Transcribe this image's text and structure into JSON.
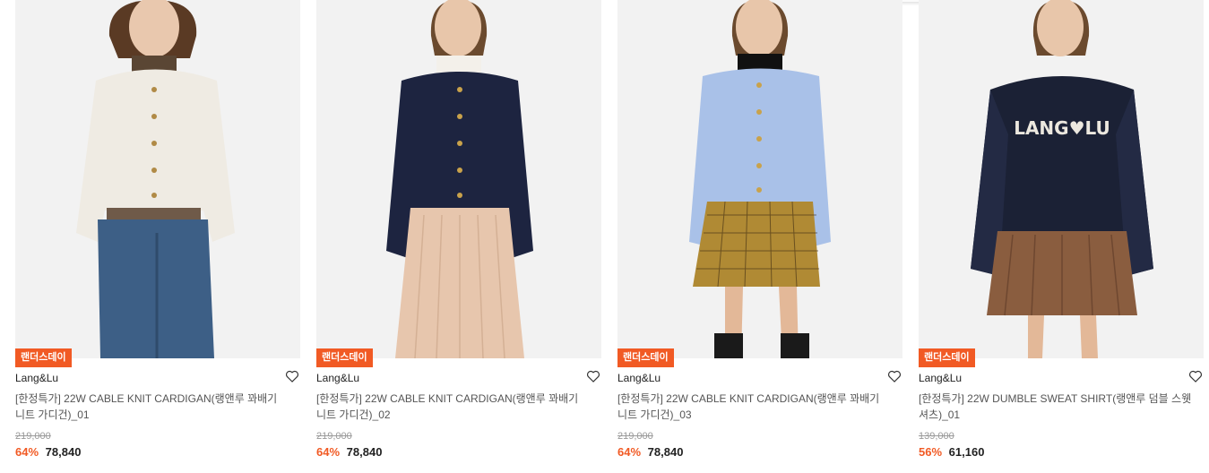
{
  "products": [
    {
      "badge": "랜더스데이",
      "brand": "Lang&Lu",
      "title": "[한정특가] 22W CABLE KNIT CARDIGAN(랭앤루 꽈배기 니트 가디건)_01",
      "original_price": "219,000",
      "discount": "64%",
      "sale_price": "78,840",
      "image": {
        "top": "ivory cable knit cardigan",
        "bottom": "blue jeans",
        "top_color": "#efebe3",
        "bottom_color": "#3d5f86",
        "inner_color": "#5a4634"
      }
    },
    {
      "badge": "랜더스데이",
      "brand": "Lang&Lu",
      "title": "[한정특가] 22W CABLE KNIT CARDIGAN(랭앤루 꽈배기 니트 가디건)_02",
      "original_price": "219,000",
      "discount": "64%",
      "sale_price": "78,840",
      "image": {
        "top": "navy cable knit cardigan",
        "bottom": "pleated skirt",
        "top_color": "#1d2440",
        "bottom_color": "#e7c6ad",
        "inner_color": "#f3f0ea"
      }
    },
    {
      "badge": "랜더스데이",
      "brand": "Lang&Lu",
      "title": "[한정특가] 22W CABLE KNIT CARDIGAN(랭앤루 꽈배기 니트 가디건)_03",
      "original_price": "219,000",
      "discount": "64%",
      "sale_price": "78,840",
      "image": {
        "top": "light blue cable knit cardigan",
        "bottom": "check mini skirt",
        "top_color": "#a9c1e8",
        "bottom_color": "#b08a34",
        "inner_color": "#111111"
      }
    },
    {
      "badge": "랜더스데이",
      "brand": "Lang&Lu",
      "title": "[한정특가] 22W DUMBLE SWEAT SHIRT(랭앤루 덤블 스웻셔츠)_01",
      "original_price": "139,000",
      "discount": "56%",
      "sale_price": "61,160",
      "image": {
        "top": "navy sweatshirt with fleece sleeves",
        "bottom": "brown pleated skirt",
        "top_color": "#1b2135",
        "bottom_color": "#8a5d3f",
        "inner_color": "#1b2135",
        "graphic_text": "LANG♥LU"
      }
    }
  ],
  "icons": {
    "wishlist": "heart-outline-icon"
  },
  "colors": {
    "accent": "#f15a24",
    "text": "#222222",
    "muted": "#999999",
    "image_bg": "#f2f2f2"
  }
}
